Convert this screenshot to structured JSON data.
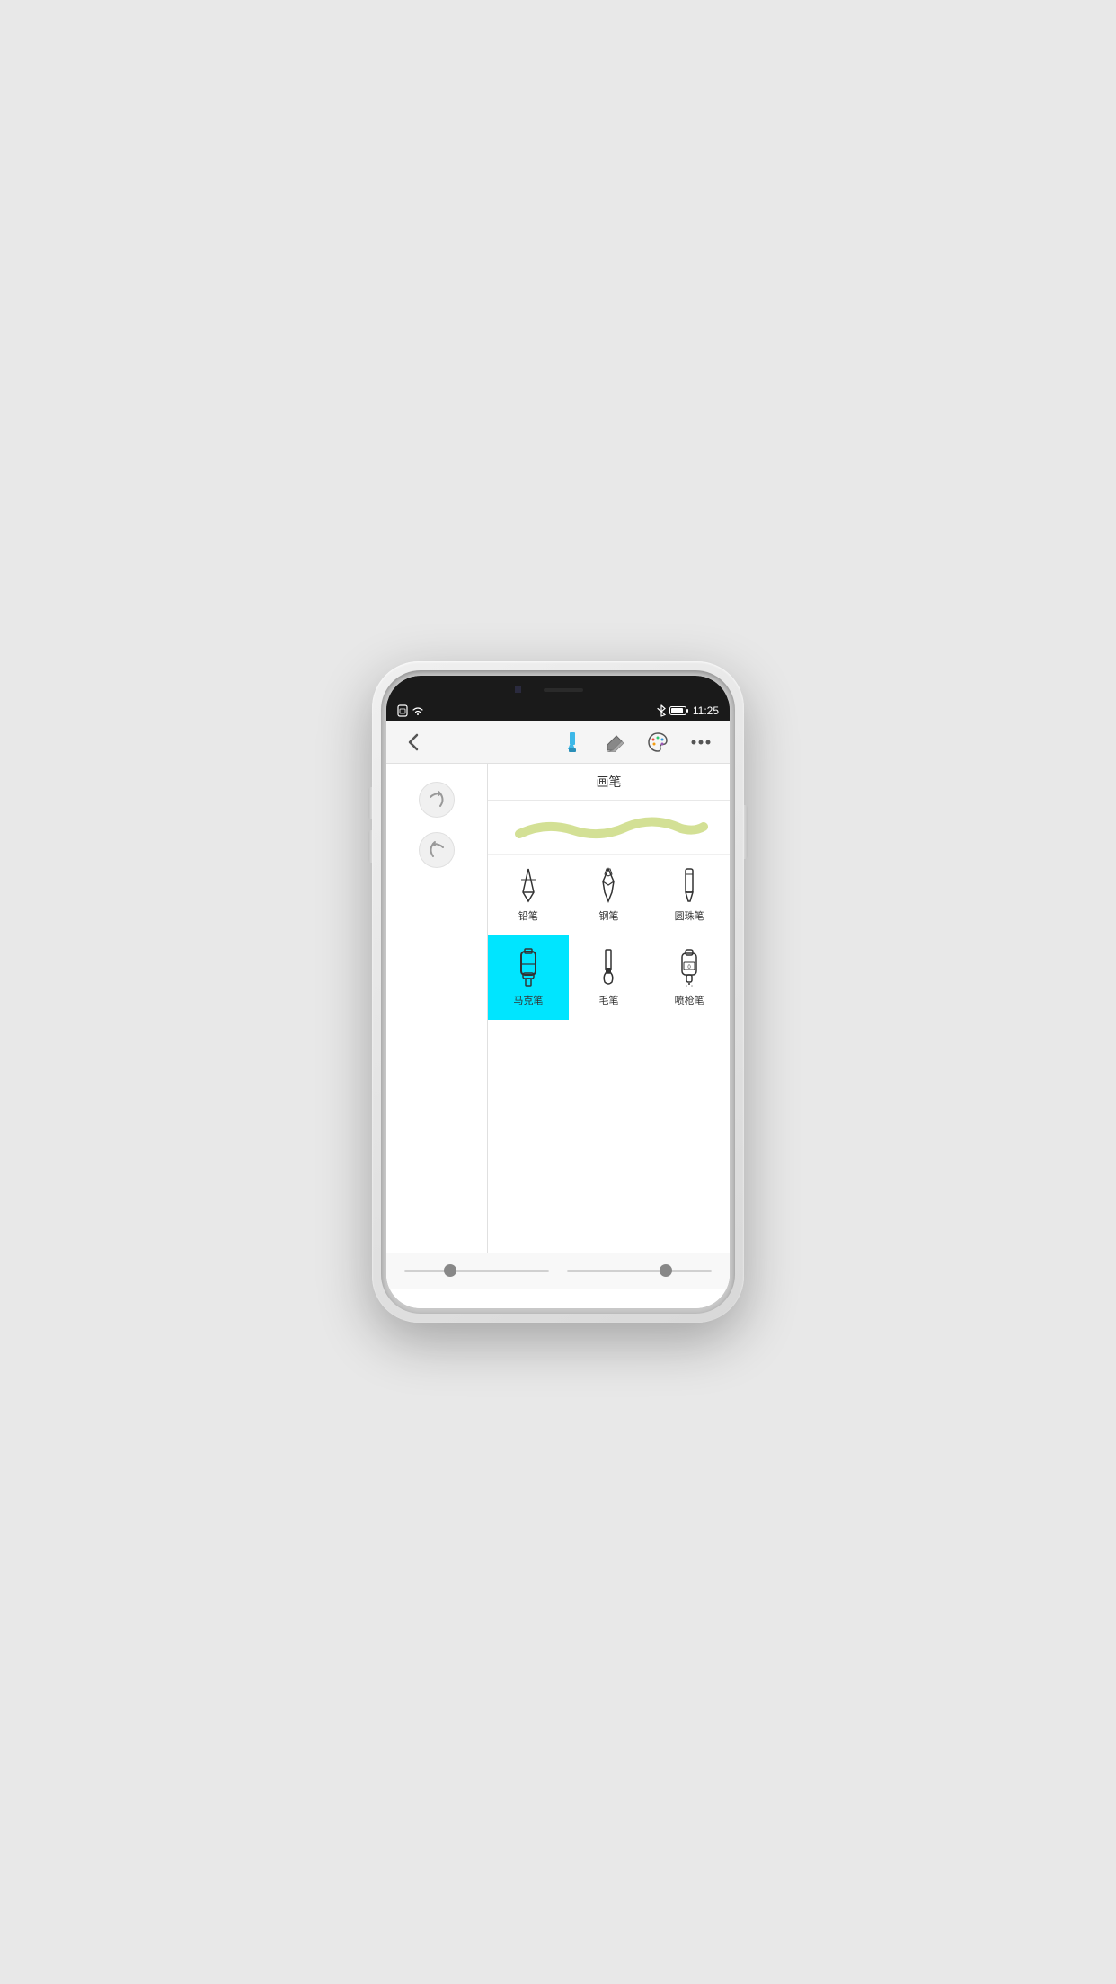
{
  "statusBar": {
    "time": "11:25",
    "icons": {
      "sim": "📄",
      "wifi": "wifi",
      "bluetooth": "bluetooth",
      "battery": "battery"
    }
  },
  "toolbar": {
    "backLabel": "‹",
    "tools": [
      "brush-tool",
      "eraser-tool",
      "palette-tool",
      "more-tool"
    ]
  },
  "panel": {
    "title": "画笔",
    "brushes": [
      {
        "id": "pencil",
        "label": "铅笔",
        "active": false
      },
      {
        "id": "pen",
        "label": "钢笔",
        "active": false
      },
      {
        "id": "ballpen",
        "label": "圆珠笔",
        "active": false
      },
      {
        "id": "marker",
        "label": "马克笔",
        "active": true
      },
      {
        "id": "brush",
        "label": "毛笔",
        "active": false
      },
      {
        "id": "spray",
        "label": "喷枪笔",
        "active": false
      }
    ]
  },
  "controls": {
    "redo": "↻",
    "undo": "↺"
  },
  "colors": {
    "activeBackground": "#00e5ff",
    "accentBlue": "#3db8e8",
    "strokePreviewColor": "#c8d87a"
  }
}
